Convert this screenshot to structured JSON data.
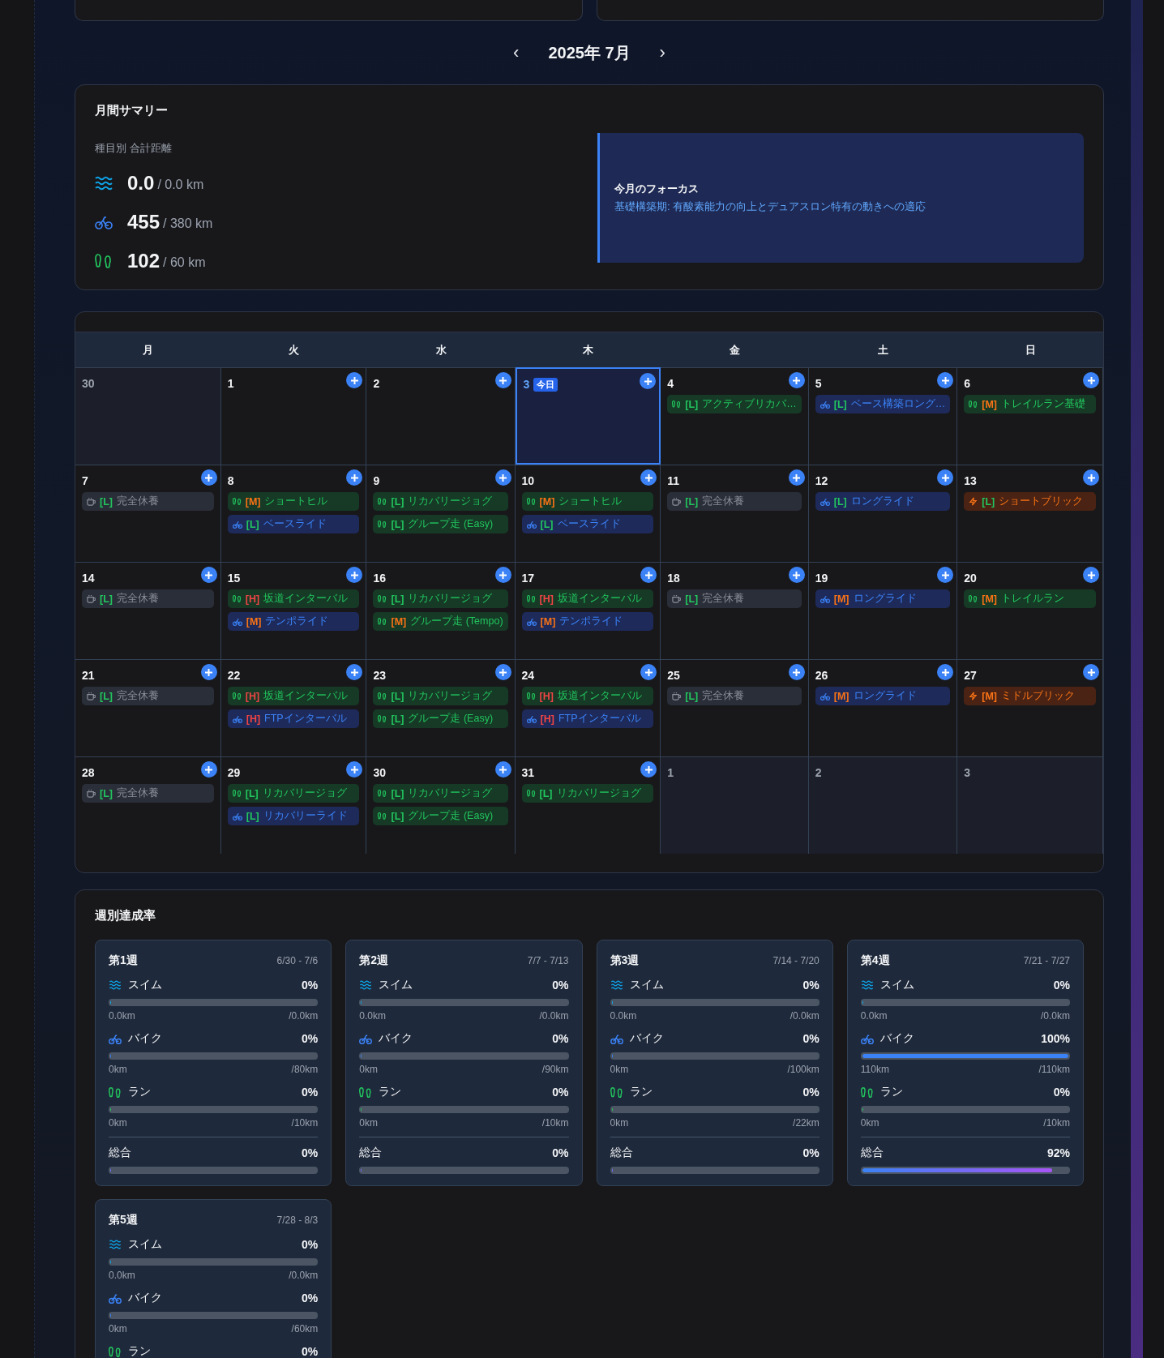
{
  "month_nav": {
    "prev": "‹",
    "title": "2025年 7月",
    "next": "›"
  },
  "summary": {
    "title": "月間サマリー",
    "subtitle": "種目別 合計距離",
    "sports": [
      {
        "kind": "swim",
        "value": "0.0",
        "target": "/ 0.0 km"
      },
      {
        "kind": "bike",
        "value": "455",
        "target": "/ 380 km"
      },
      {
        "kind": "run",
        "value": "102",
        "target": "/ 60 km"
      }
    ],
    "focus": {
      "title": "今月のフォーカス",
      "text": "基礎構築期: 有酸素能力の向上とデュアスロン特有の動きへの適応"
    }
  },
  "calendar": {
    "weekdays": [
      "月",
      "火",
      "水",
      "木",
      "金",
      "土",
      "日"
    ],
    "today_badge": "今日",
    "weeks": [
      [
        {
          "date": "30",
          "in_month": false,
          "today": false
        },
        {
          "date": "1",
          "in_month": true,
          "today": false
        },
        {
          "date": "2",
          "in_month": true,
          "today": false
        },
        {
          "date": "3",
          "in_month": true,
          "today": true
        },
        {
          "date": "4",
          "in_month": true,
          "today": false,
          "events": [
            {
              "kind": "run",
              "color": "#22c55e",
              "tag": "[L]",
              "title": "アクティブリカバ…"
            }
          ]
        },
        {
          "date": "5",
          "in_month": true,
          "today": false,
          "events": [
            {
              "kind": "bike",
              "color": "#22c55e",
              "tag": "[L]",
              "title": "ベース構築ロング…"
            }
          ]
        },
        {
          "date": "6",
          "in_month": true,
          "today": false,
          "events": [
            {
              "kind": "run",
              "color": "#f97316",
              "tag": "[M]",
              "title": "トレイルラン基礎"
            }
          ]
        }
      ],
      [
        {
          "date": "7",
          "in_month": true,
          "today": false,
          "events": [
            {
              "kind": "rest",
              "color": "#22c55e",
              "tag": "[L]",
              "title": "完全休養"
            }
          ]
        },
        {
          "date": "8",
          "in_month": true,
          "today": false,
          "events": [
            {
              "kind": "run",
              "color": "#f97316",
              "tag": "[M]",
              "title": "ショートヒル"
            },
            {
              "kind": "bike",
              "color": "#22c55e",
              "tag": "[L]",
              "title": "ベースライド"
            }
          ]
        },
        {
          "date": "9",
          "in_month": true,
          "today": false,
          "events": [
            {
              "kind": "run",
              "color": "#22c55e",
              "tag": "[L]",
              "title": "リカバリージョグ"
            },
            {
              "kind": "run",
              "color": "#22c55e",
              "tag": "[L]",
              "title": "グループ走 (Easy)"
            }
          ]
        },
        {
          "date": "10",
          "in_month": true,
          "today": false,
          "events": [
            {
              "kind": "run",
              "color": "#f97316",
              "tag": "[M]",
              "title": "ショートヒル"
            },
            {
              "kind": "bike",
              "color": "#22c55e",
              "tag": "[L]",
              "title": "ベースライド"
            }
          ]
        },
        {
          "date": "11",
          "in_month": true,
          "today": false,
          "events": [
            {
              "kind": "rest",
              "color": "#22c55e",
              "tag": "[L]",
              "title": "完全休養"
            }
          ]
        },
        {
          "date": "12",
          "in_month": true,
          "today": false,
          "events": [
            {
              "kind": "bike",
              "color": "#22c55e",
              "tag": "[L]",
              "title": "ロングライド"
            }
          ]
        },
        {
          "date": "13",
          "in_month": true,
          "today": false,
          "events": [
            {
              "kind": "brick",
              "color": "#22c55e",
              "tag": "[L]",
              "title": "ショートブリック"
            }
          ]
        }
      ],
      [
        {
          "date": "14",
          "in_month": true,
          "today": false,
          "events": [
            {
              "kind": "rest",
              "color": "#22c55e",
              "tag": "[L]",
              "title": "完全休養"
            }
          ]
        },
        {
          "date": "15",
          "in_month": true,
          "today": false,
          "events": [
            {
              "kind": "run",
              "color": "#ef4444",
              "tag": "[H]",
              "title": "坂道インターバル"
            },
            {
              "kind": "bike",
              "color": "#f97316",
              "tag": "[M]",
              "title": "テンポライド"
            }
          ]
        },
        {
          "date": "16",
          "in_month": true,
          "today": false,
          "events": [
            {
              "kind": "run",
              "color": "#22c55e",
              "tag": "[L]",
              "title": "リカバリージョグ"
            },
            {
              "kind": "run",
              "color": "#f97316",
              "tag": "[M]",
              "title": "グループ走 (Tempo)"
            }
          ]
        },
        {
          "date": "17",
          "in_month": true,
          "today": false,
          "events": [
            {
              "kind": "run",
              "color": "#ef4444",
              "tag": "[H]",
              "title": "坂道インターバル"
            },
            {
              "kind": "bike",
              "color": "#f97316",
              "tag": "[M]",
              "title": "テンポライド"
            }
          ]
        },
        {
          "date": "18",
          "in_month": true,
          "today": false,
          "events": [
            {
              "kind": "rest",
              "color": "#22c55e",
              "tag": "[L]",
              "title": "完全休養"
            }
          ]
        },
        {
          "date": "19",
          "in_month": true,
          "today": false,
          "events": [
            {
              "kind": "bike",
              "color": "#f97316",
              "tag": "[M]",
              "title": "ロングライド"
            }
          ]
        },
        {
          "date": "20",
          "in_month": true,
          "today": false,
          "events": [
            {
              "kind": "run",
              "color": "#f97316",
              "tag": "[M]",
              "title": "トレイルラン"
            }
          ]
        }
      ],
      [
        {
          "date": "21",
          "in_month": true,
          "today": false,
          "events": [
            {
              "kind": "rest",
              "color": "#22c55e",
              "tag": "[L]",
              "title": "完全休養"
            }
          ]
        },
        {
          "date": "22",
          "in_month": true,
          "today": false,
          "events": [
            {
              "kind": "run",
              "color": "#ef4444",
              "tag": "[H]",
              "title": "坂道インターバル"
            },
            {
              "kind": "bike",
              "color": "#ef4444",
              "tag": "[H]",
              "title": "FTPインターバル"
            }
          ]
        },
        {
          "date": "23",
          "in_month": true,
          "today": false,
          "events": [
            {
              "kind": "run",
              "color": "#22c55e",
              "tag": "[L]",
              "title": "リカバリージョグ"
            },
            {
              "kind": "run",
              "color": "#22c55e",
              "tag": "[L]",
              "title": "グループ走 (Easy)"
            }
          ]
        },
        {
          "date": "24",
          "in_month": true,
          "today": false,
          "events": [
            {
              "kind": "run",
              "color": "#ef4444",
              "tag": "[H]",
              "title": "坂道インターバル"
            },
            {
              "kind": "bike",
              "color": "#ef4444",
              "tag": "[H]",
              "title": "FTPインターバル"
            }
          ]
        },
        {
          "date": "25",
          "in_month": true,
          "today": false,
          "events": [
            {
              "kind": "rest",
              "color": "#22c55e",
              "tag": "[L]",
              "title": "完全休養"
            }
          ]
        },
        {
          "date": "26",
          "in_month": true,
          "today": false,
          "events": [
            {
              "kind": "bike",
              "color": "#f97316",
              "tag": "[M]",
              "title": "ロングライド"
            }
          ]
        },
        {
          "date": "27",
          "in_month": true,
          "today": false,
          "events": [
            {
              "kind": "brick",
              "color": "#f97316",
              "tag": "[M]",
              "title": "ミドルブリック"
            }
          ]
        }
      ],
      [
        {
          "date": "28",
          "in_month": true,
          "today": false,
          "events": [
            {
              "kind": "rest",
              "color": "#22c55e",
              "tag": "[L]",
              "title": "完全休養"
            }
          ]
        },
        {
          "date": "29",
          "in_month": true,
          "today": false,
          "events": [
            {
              "kind": "run",
              "color": "#22c55e",
              "tag": "[L]",
              "title": "リカバリージョグ"
            },
            {
              "kind": "bike",
              "color": "#22c55e",
              "tag": "[L]",
              "title": "リカバリーライド"
            }
          ]
        },
        {
          "date": "30",
          "in_month": true,
          "today": false,
          "events": [
            {
              "kind": "run",
              "color": "#22c55e",
              "tag": "[L]",
              "title": "リカバリージョグ"
            },
            {
              "kind": "run",
              "color": "#22c55e",
              "tag": "[L]",
              "title": "グループ走 (Easy)"
            }
          ]
        },
        {
          "date": "31",
          "in_month": true,
          "today": false,
          "events": [
            {
              "kind": "run",
              "color": "#22c55e",
              "tag": "[L]",
              "title": "リカバリージョグ"
            }
          ]
        },
        {
          "date": "1",
          "in_month": false,
          "today": false
        },
        {
          "date": "2",
          "in_month": false,
          "today": false
        },
        {
          "date": "3",
          "in_month": false,
          "today": false
        }
      ]
    ]
  },
  "weekly": {
    "title": "週別達成率",
    "weeks": [
      {
        "title": "第1週",
        "range": "6/30 - 7/6",
        "metrics": [
          {
            "kind": "swim",
            "label": "スイム",
            "percent": "0%",
            "level": 0,
            "done": "0.0km",
            "target": "/0.0km"
          },
          {
            "kind": "bike",
            "label": "バイク",
            "percent": "0%",
            "level": 0,
            "done": "0km",
            "target": "/80km"
          },
          {
            "kind": "run",
            "label": "ラン",
            "percent": "0%",
            "level": 0,
            "done": "0km",
            "target": "/10km"
          }
        ],
        "total": {
          "label": "総合",
          "percent": "0%",
          "level": 0
        }
      },
      {
        "title": "第2週",
        "range": "7/7 - 7/13",
        "metrics": [
          {
            "kind": "swim",
            "label": "スイム",
            "percent": "0%",
            "level": 0,
            "done": "0.0km",
            "target": "/0.0km"
          },
          {
            "kind": "bike",
            "label": "バイク",
            "percent": "0%",
            "level": 0,
            "done": "0km",
            "target": "/90km"
          },
          {
            "kind": "run",
            "label": "ラン",
            "percent": "0%",
            "level": 0,
            "done": "0km",
            "target": "/10km"
          }
        ],
        "total": {
          "label": "総合",
          "percent": "0%",
          "level": 0
        }
      },
      {
        "title": "第3週",
        "range": "7/14 - 7/20",
        "metrics": [
          {
            "kind": "swim",
            "label": "スイム",
            "percent": "0%",
            "level": 0,
            "done": "0.0km",
            "target": "/0.0km"
          },
          {
            "kind": "bike",
            "label": "バイク",
            "percent": "0%",
            "level": 0,
            "done": "0km",
            "target": "/100km"
          },
          {
            "kind": "run",
            "label": "ラン",
            "percent": "0%",
            "level": 0,
            "done": "0km",
            "target": "/22km"
          }
        ],
        "total": {
          "label": "総合",
          "percent": "0%",
          "level": 0
        }
      },
      {
        "title": "第4週",
        "range": "7/21 - 7/27",
        "metrics": [
          {
            "kind": "swim",
            "label": "スイム",
            "percent": "0%",
            "level": 0,
            "done": "0.0km",
            "target": "/0.0km"
          },
          {
            "kind": "bike",
            "label": "バイク",
            "percent": "100%",
            "level": 1,
            "done": "110km",
            "target": "/110km"
          },
          {
            "kind": "run",
            "label": "ラン",
            "percent": "0%",
            "level": 0,
            "done": "0km",
            "target": "/10km"
          }
        ],
        "total": {
          "label": "総合",
          "percent": "92%",
          "level": 0.92
        }
      },
      {
        "title": "第5週",
        "range": "7/28 - 8/3",
        "metrics": [
          {
            "kind": "swim",
            "label": "スイム",
            "percent": "0%",
            "level": 0,
            "done": "0.0km",
            "target": "/0.0km"
          },
          {
            "kind": "bike",
            "label": "バイク",
            "percent": "0%",
            "level": 0,
            "done": "0km",
            "target": "/60km"
          },
          {
            "kind": "run",
            "label": "ラン",
            "percent": "0%"
          }
        ]
      }
    ]
  }
}
